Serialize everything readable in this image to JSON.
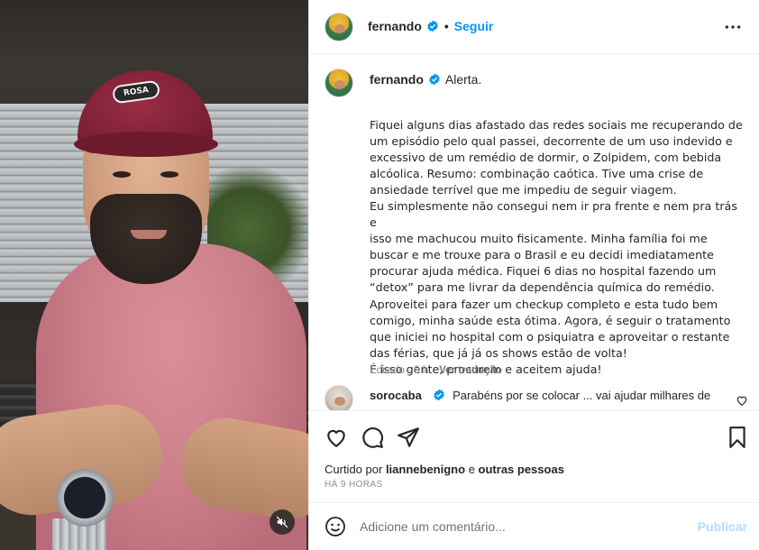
{
  "post": {
    "author": "fernando",
    "follow_label": "Seguir",
    "dot": "•",
    "caption_first": "Alerta.",
    "caption_body": "Fiquei alguns dias afastado das redes sociais me recuperando de\num episódio pelo qual passei, decorrente de um uso indevido e\nexcessivo de um remédio de dormir, o Zolpidem, com bebida\nalcóolica. Resumo: combinação caótica. Tive uma crise de\nansiedade terrível que me impediu de seguir viagem.\nEu simplesmente não consegui nem ir pra frente e nem pra trás e\nisso me machucou muito fisicamente. Minha família foi me\nbuscar e me trouxe para o Brasil e eu decidi imediatamente\nprocurar ajuda médica. Fiquei 6 dias no hospital fazendo um\n“detox” para me livrar da dependência química do remédio.\nAproveitei para fazer um checkup completo e esta tudo bem\ncomigo, minha saúde esta ótima. Agora, é seguir o tratamento\nque iniciei no hospital com o psiquiatra e aproveitar o restante\ndas férias, que já já os shows estão de volta!\nÉ isso gente, procurem e aceitem ajuda!",
    "edited_label": "Editado · 9 h",
    "translate_label": "Ver tradução",
    "cap_logo": "ROSA"
  },
  "comment": {
    "author": "sorocaba",
    "text": "Parabéns por se colocar ... vai ajudar milhares de"
  },
  "likes": {
    "prefix": "Curtido por",
    "user": "liannebenigno",
    "connector": "e",
    "others": "outras pessoas"
  },
  "timestamp": "HÁ 9 HORAS",
  "add_comment": {
    "placeholder": "Adicione um comentário...",
    "post_label": "Publicar"
  },
  "icons": {
    "more": "more-horizontal-icon",
    "verified": "verified-badge-icon",
    "like": "heart-icon",
    "comment": "comment-bubble-icon",
    "share": "paper-plane-icon",
    "save": "bookmark-icon",
    "emoji": "smiley-icon",
    "mute": "speaker-muted-icon"
  },
  "colors": {
    "accent": "#0095f6",
    "verified": "#0095f6",
    "text": "#262626",
    "muted": "#8e8e8e",
    "publish_disabled": "#b3dbff"
  }
}
